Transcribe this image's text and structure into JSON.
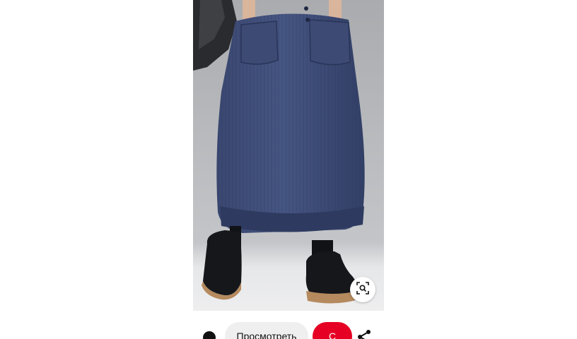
{
  "pin": {
    "view_label": "Просмотреть",
    "save_label": "С",
    "icons": {
      "lens": "visual-search-icon",
      "share": "share-icon",
      "profile": "avatar"
    },
    "colors": {
      "save_button": "#e60023",
      "view_button": "#efefef"
    }
  }
}
